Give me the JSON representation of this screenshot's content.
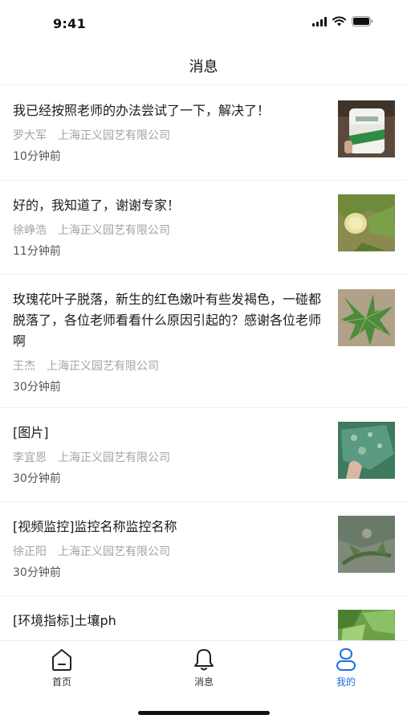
{
  "status_bar": {
    "time": "9:41"
  },
  "header": {
    "title": "消息"
  },
  "messages": [
    {
      "text": "我已经按照老师的办法尝试了一下，解决了！",
      "author": "罗大军",
      "org": "上海正义园艺有限公司",
      "time": "10分钟前",
      "thumb": "pesticide-bottle-photo"
    },
    {
      "text": "好的，我知道了，谢谢专家！",
      "author": "徐峥浩",
      "org": "上海正义园艺有限公司",
      "time": "11分钟前",
      "thumb": "melon-plant-photo"
    },
    {
      "text": "玫瑰花叶子脱落，新生的红色嫩叶有些发褐色，一碰都脱落了，各位老师看看什么原因引起的？感谢各位老师啊",
      "author": "王杰",
      "org": "上海正义园艺有限公司",
      "time": "30分钟前",
      "thumb": "leaf-closeup-photo"
    },
    {
      "text": "[图片]",
      "author": "李宜恩",
      "org": "上海正义园艺有限公司",
      "time": "30分钟前",
      "thumb": "diseased-leaf-photo"
    },
    {
      "text": "[视频监控]监控名称监控名称",
      "author": "徐正阳",
      "org": "上海正义园艺有限公司",
      "time": "30分钟前",
      "thumb": "vine-closeup-photo"
    },
    {
      "text": "[环境指标]土壤ph",
      "author": "",
      "org": "",
      "time": "",
      "thumb": "green-leaves-photo"
    }
  ],
  "tabs": [
    {
      "label": "首页",
      "icon": "home-icon",
      "active": false
    },
    {
      "label": "消息",
      "icon": "bell-icon",
      "active": false
    },
    {
      "label": "我的",
      "icon": "profile-icon",
      "active": true
    }
  ],
  "colors": {
    "accent": "#1f6fe0",
    "text": "#1c1c1c",
    "meta": "#a3a3a3",
    "time": "#555555"
  }
}
